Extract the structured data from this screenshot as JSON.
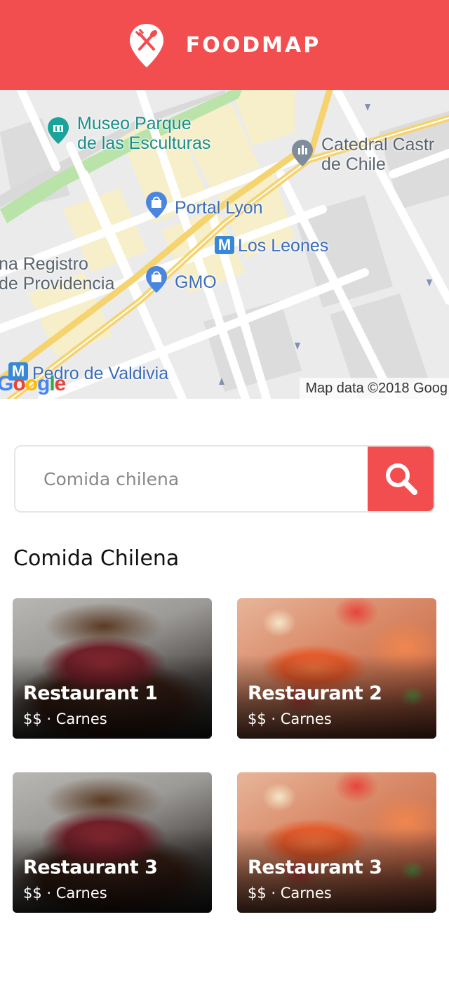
{
  "header": {
    "brand": "FOODMAP",
    "logo_icon": "map-pin-fork-knife-icon",
    "background": "#f24e50"
  },
  "map": {
    "labels": {
      "museo_line1": "Museo Parque",
      "museo_line2": "de las Esculturas",
      "catedral_line1": "Catedral Castr",
      "catedral_line2": "de Chile",
      "portal_lyon": "Portal Lyon",
      "los_leones": "Los Leones",
      "registro_line1": "na Registro",
      "registro_line2": "de Providencia",
      "gmo": "GMO",
      "pedro_valdivia": "Pedro de Valdivia"
    },
    "metro_glyph": "M",
    "google_logo": "Google",
    "credit": "Map data ©2018 Goog"
  },
  "search": {
    "placeholder": "Comida chilena",
    "button_icon": "search-icon"
  },
  "section_title": "Comida Chilena",
  "restaurants": [
    {
      "name": "Restaurant 1",
      "meta": "$$ · Carnes",
      "image": "steak"
    },
    {
      "name": "Restaurant 2",
      "meta": "$$ · Carnes",
      "image": "shrimp"
    },
    {
      "name": "Restaurant 3",
      "meta": "$$ · Carnes",
      "image": "steak"
    },
    {
      "name": "Restaurant 3",
      "meta": "$$ · Carnes",
      "image": "shrimp"
    }
  ]
}
